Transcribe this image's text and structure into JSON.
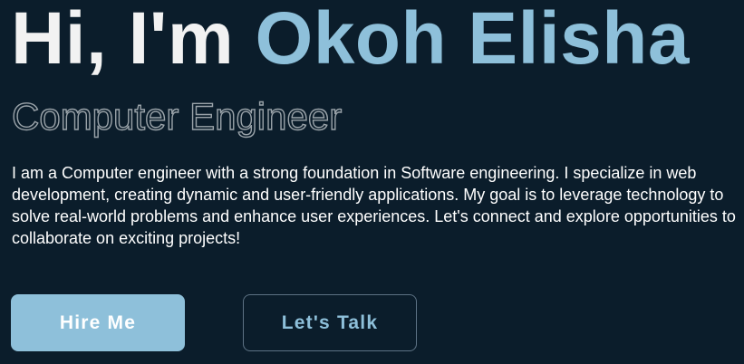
{
  "hero": {
    "greeting_prefix": "Hi, I'm ",
    "name": "Okoh Elisha",
    "role": "Computer Engineer",
    "bio": "I am a Computer engineer with a strong foundation in Software engineering. I specialize in web development, creating dynamic and user-friendly applications. My goal is to leverage technology to solve real-world problems and enhance user experiences. Let's connect and explore opportunities to collaborate on exciting projects!"
  },
  "actions": {
    "hire_label": "Hire Me",
    "talk_label": "Let's Talk"
  },
  "colors": {
    "background": "#0b1d2b",
    "accent": "#8ec0da",
    "heading_text": "#f2f2f2",
    "outline_text": "#9aa3a9",
    "button_border": "#5d7284"
  }
}
